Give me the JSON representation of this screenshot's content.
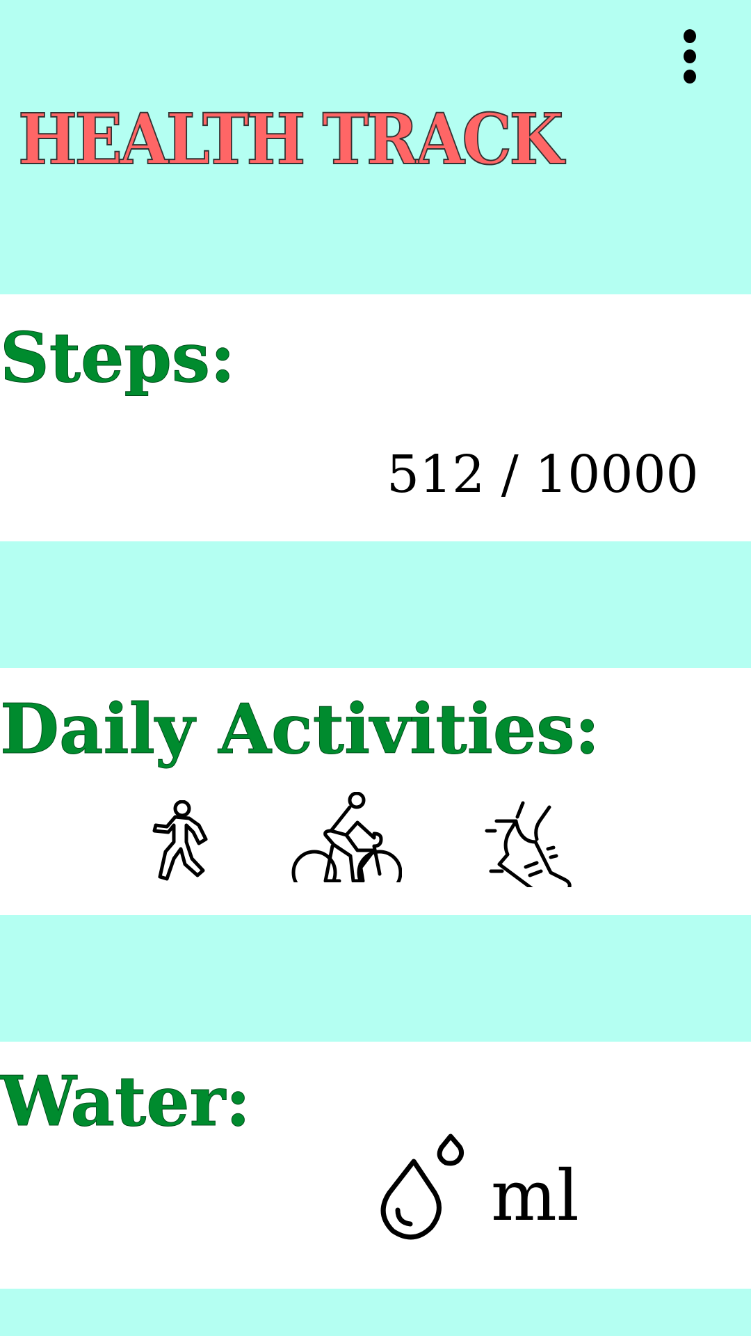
{
  "header": {
    "title": "HEALTH TRACK",
    "menu_icon": "more-vert-icon"
  },
  "steps": {
    "heading": "Steps:",
    "value": "512 / 10000",
    "current": 512,
    "goal": 10000
  },
  "activities": {
    "heading": "Daily Activities:",
    "icons": [
      "walking-icon",
      "cycling-icon",
      "running-shoe-icon"
    ]
  },
  "water": {
    "heading": "Water:",
    "icon": "water-drop-icon",
    "unit": "ml"
  },
  "colors": {
    "background": "#b4fff2",
    "title": "#ff6666",
    "heading": "#008b2e",
    "card": "#ffffff"
  }
}
